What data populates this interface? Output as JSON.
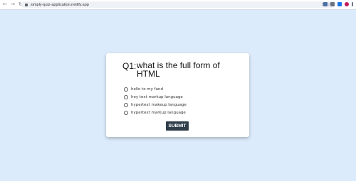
{
  "browser": {
    "url": "simply-quiz-application.netlify.app",
    "nav": {
      "back": "←",
      "forward": "→",
      "reload": "↻"
    },
    "address_icons": [
      "share-icon",
      "star-icon"
    ],
    "toolbar_icons": [
      {
        "name": "extensions-icon",
        "color": "#4a6fa5"
      },
      {
        "name": "profile-icon",
        "color": "#6b7280"
      },
      {
        "name": "sidebar-icon",
        "color": "#1a73e8"
      },
      {
        "name": "avatar-icon",
        "color": "#c2185b"
      },
      {
        "name": "menu-icon",
        "color": "#6b7280"
      }
    ]
  },
  "quiz": {
    "question_label": "Q1:",
    "question": "what is the full form of HTML",
    "options": [
      "hello to my fand",
      "hey text markup language",
      "hypertext makeup language",
      "hypertext markup language"
    ],
    "submit_label": "SUBMIT"
  },
  "colors": {
    "background": "#dcebfb",
    "card": "#ffffff",
    "button": "#2f3d4a"
  }
}
